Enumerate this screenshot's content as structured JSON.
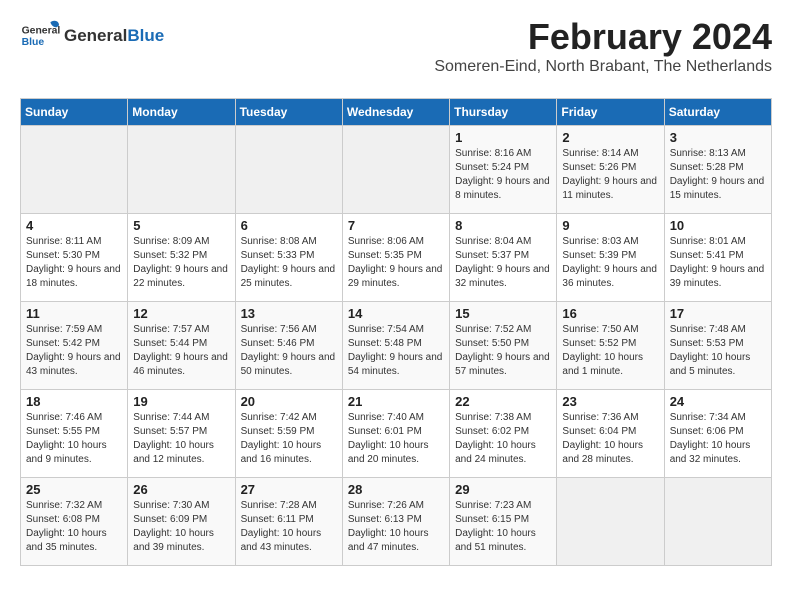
{
  "header": {
    "logo_general": "General",
    "logo_blue": "Blue",
    "month": "February 2024",
    "location": "Someren-Eind, North Brabant, The Netherlands"
  },
  "weekdays": [
    "Sunday",
    "Monday",
    "Tuesday",
    "Wednesday",
    "Thursday",
    "Friday",
    "Saturday"
  ],
  "weeks": [
    [
      {
        "day": "",
        "info": ""
      },
      {
        "day": "",
        "info": ""
      },
      {
        "day": "",
        "info": ""
      },
      {
        "day": "",
        "info": ""
      },
      {
        "day": "1",
        "info": "Sunrise: 8:16 AM\nSunset: 5:24 PM\nDaylight: 9 hours\nand 8 minutes."
      },
      {
        "day": "2",
        "info": "Sunrise: 8:14 AM\nSunset: 5:26 PM\nDaylight: 9 hours\nand 11 minutes."
      },
      {
        "day": "3",
        "info": "Sunrise: 8:13 AM\nSunset: 5:28 PM\nDaylight: 9 hours\nand 15 minutes."
      }
    ],
    [
      {
        "day": "4",
        "info": "Sunrise: 8:11 AM\nSunset: 5:30 PM\nDaylight: 9 hours\nand 18 minutes."
      },
      {
        "day": "5",
        "info": "Sunrise: 8:09 AM\nSunset: 5:32 PM\nDaylight: 9 hours\nand 22 minutes."
      },
      {
        "day": "6",
        "info": "Sunrise: 8:08 AM\nSunset: 5:33 PM\nDaylight: 9 hours\nand 25 minutes."
      },
      {
        "day": "7",
        "info": "Sunrise: 8:06 AM\nSunset: 5:35 PM\nDaylight: 9 hours\nand 29 minutes."
      },
      {
        "day": "8",
        "info": "Sunrise: 8:04 AM\nSunset: 5:37 PM\nDaylight: 9 hours\nand 32 minutes."
      },
      {
        "day": "9",
        "info": "Sunrise: 8:03 AM\nSunset: 5:39 PM\nDaylight: 9 hours\nand 36 minutes."
      },
      {
        "day": "10",
        "info": "Sunrise: 8:01 AM\nSunset: 5:41 PM\nDaylight: 9 hours\nand 39 minutes."
      }
    ],
    [
      {
        "day": "11",
        "info": "Sunrise: 7:59 AM\nSunset: 5:42 PM\nDaylight: 9 hours\nand 43 minutes."
      },
      {
        "day": "12",
        "info": "Sunrise: 7:57 AM\nSunset: 5:44 PM\nDaylight: 9 hours\nand 46 minutes."
      },
      {
        "day": "13",
        "info": "Sunrise: 7:56 AM\nSunset: 5:46 PM\nDaylight: 9 hours\nand 50 minutes."
      },
      {
        "day": "14",
        "info": "Sunrise: 7:54 AM\nSunset: 5:48 PM\nDaylight: 9 hours\nand 54 minutes."
      },
      {
        "day": "15",
        "info": "Sunrise: 7:52 AM\nSunset: 5:50 PM\nDaylight: 9 hours\nand 57 minutes."
      },
      {
        "day": "16",
        "info": "Sunrise: 7:50 AM\nSunset: 5:52 PM\nDaylight: 10 hours\nand 1 minute."
      },
      {
        "day": "17",
        "info": "Sunrise: 7:48 AM\nSunset: 5:53 PM\nDaylight: 10 hours\nand 5 minutes."
      }
    ],
    [
      {
        "day": "18",
        "info": "Sunrise: 7:46 AM\nSunset: 5:55 PM\nDaylight: 10 hours\nand 9 minutes."
      },
      {
        "day": "19",
        "info": "Sunrise: 7:44 AM\nSunset: 5:57 PM\nDaylight: 10 hours\nand 12 minutes."
      },
      {
        "day": "20",
        "info": "Sunrise: 7:42 AM\nSunset: 5:59 PM\nDaylight: 10 hours\nand 16 minutes."
      },
      {
        "day": "21",
        "info": "Sunrise: 7:40 AM\nSunset: 6:01 PM\nDaylight: 10 hours\nand 20 minutes."
      },
      {
        "day": "22",
        "info": "Sunrise: 7:38 AM\nSunset: 6:02 PM\nDaylight: 10 hours\nand 24 minutes."
      },
      {
        "day": "23",
        "info": "Sunrise: 7:36 AM\nSunset: 6:04 PM\nDaylight: 10 hours\nand 28 minutes."
      },
      {
        "day": "24",
        "info": "Sunrise: 7:34 AM\nSunset: 6:06 PM\nDaylight: 10 hours\nand 32 minutes."
      }
    ],
    [
      {
        "day": "25",
        "info": "Sunrise: 7:32 AM\nSunset: 6:08 PM\nDaylight: 10 hours\nand 35 minutes."
      },
      {
        "day": "26",
        "info": "Sunrise: 7:30 AM\nSunset: 6:09 PM\nDaylight: 10 hours\nand 39 minutes."
      },
      {
        "day": "27",
        "info": "Sunrise: 7:28 AM\nSunset: 6:11 PM\nDaylight: 10 hours\nand 43 minutes."
      },
      {
        "day": "28",
        "info": "Sunrise: 7:26 AM\nSunset: 6:13 PM\nDaylight: 10 hours\nand 47 minutes."
      },
      {
        "day": "29",
        "info": "Sunrise: 7:23 AM\nSunset: 6:15 PM\nDaylight: 10 hours\nand 51 minutes."
      },
      {
        "day": "",
        "info": ""
      },
      {
        "day": "",
        "info": ""
      }
    ]
  ]
}
